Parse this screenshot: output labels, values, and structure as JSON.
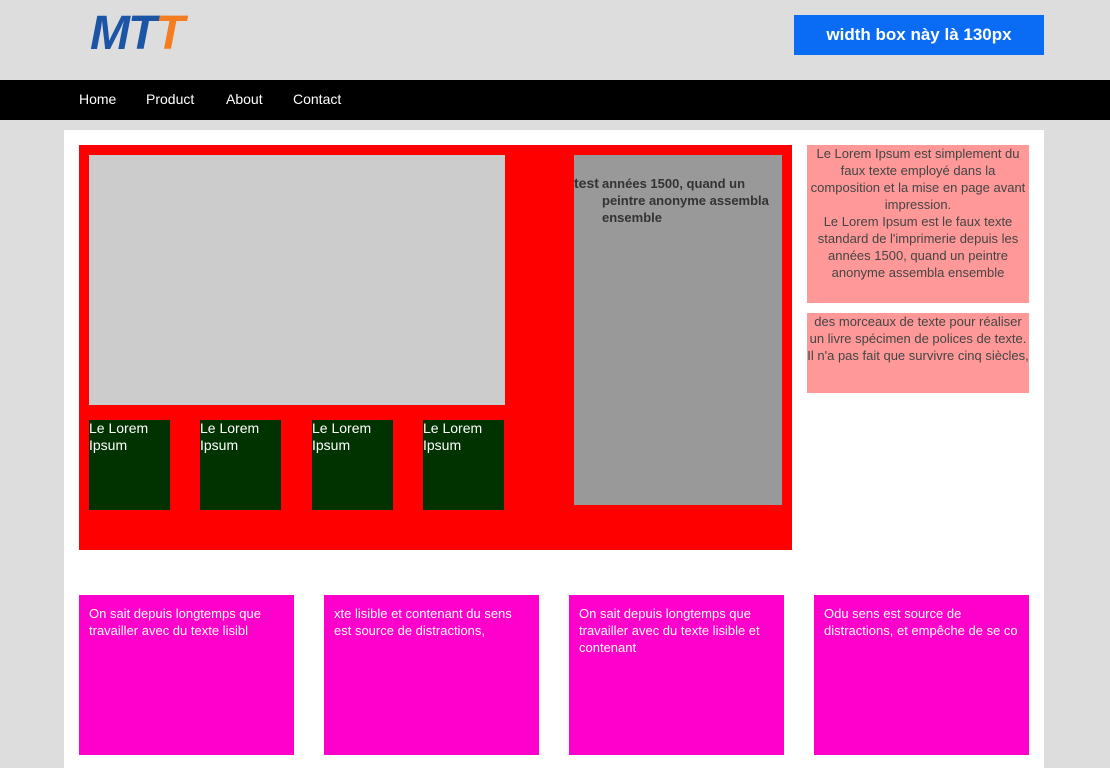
{
  "header": {
    "logo": {
      "m": "M",
      "t1": "T",
      "t2": "T"
    },
    "width_box_label": "width box này là 130px"
  },
  "nav": {
    "items": [
      "Home",
      "Product",
      "About",
      "Contact"
    ]
  },
  "main": {
    "thumbs": [
      "Le Lorem Ipsum",
      "Le Lorem Ipsum",
      "Le Lorem Ipsum",
      "Le Lorem Ipsum"
    ],
    "side_box": {
      "label": "test",
      "text": "années 1500, quand un peintre anonyme assembla ensemble"
    }
  },
  "aside": {
    "box1": {
      "line1": "Le Lorem Ipsum est simplement du faux texte employé dans la composition et la mise en page avant impression.",
      "line2": "Le Lorem Ipsum est le faux texte standard de l'imprimerie depuis les années 1500, quand un peintre anonyme assembla ensemble"
    },
    "box2": "des morceaux de texte pour réaliser un livre spécimen de polices de texte. Il n'a pas fait que survivre cinq siècles,"
  },
  "cards": [
    "On sait depuis longtemps que travailler avec du texte lisibl",
    "xte lisible et contenant du sens est source de distractions,",
    "On sait depuis longtemps que travailler avec du texte lisible et contenant",
    "Odu sens est source de distractions, et empêche de se co"
  ],
  "colors": {
    "header_bg": "#dddddd",
    "nav_bg": "#000000",
    "width_box": "#0a6cf4",
    "red_box": "#ff0000",
    "thumb": "#003300",
    "pink": "#ff9999",
    "magenta": "#ff00cc"
  }
}
